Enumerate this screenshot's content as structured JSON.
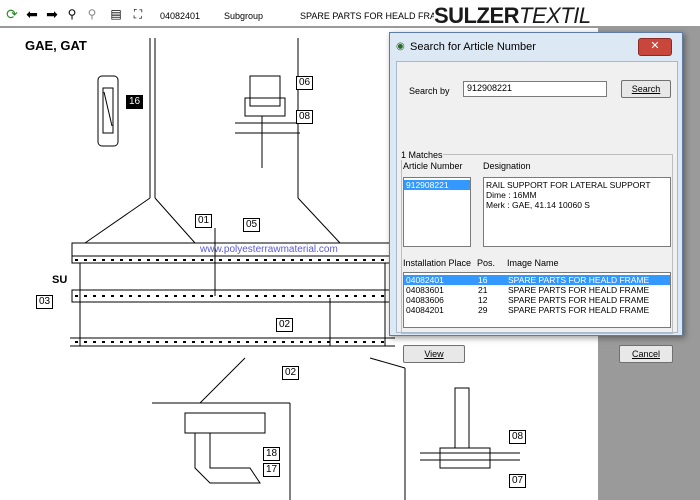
{
  "toolbar": {
    "doc_number": "04082401",
    "subgroup_label": "Subgroup",
    "page_title": "SPARE PARTS FOR HEALD FRAME",
    "logo_bold": "SULZER",
    "logo_light": "TEXTIL"
  },
  "drawing": {
    "model": "GAE, GAT",
    "side_label": "SU",
    "watermark": "www.polyesterrawmaterial.com",
    "parts": [
      "16",
      "06",
      "08",
      "01",
      "05",
      "03",
      "02",
      "02",
      "18",
      "17",
      "08",
      "07"
    ]
  },
  "dialog": {
    "title": "Search for Article Number",
    "close": "✕",
    "search_label": "Search by",
    "search_value": "912908221",
    "search_button": "Search",
    "matches": "1 Matches",
    "col_article": "Article Number",
    "col_designation": "Designation",
    "article_selected": "912908221",
    "designation_lines": [
      "RAIL SUPPORT FOR LATERAL SUPPORT",
      "Dime : 16MM",
      "Merk : GAE, 41.14 10060 S"
    ],
    "col_install": "Installation Place",
    "col_pos": "Pos.",
    "col_image": "Image Name",
    "rows": [
      {
        "place": "04082401",
        "pos": "16",
        "image": "SPARE PARTS FOR HEALD FRAME"
      },
      {
        "place": "04083601",
        "pos": "21",
        "image": "SPARE PARTS FOR HEALD FRAME"
      },
      {
        "place": "04083606",
        "pos": "12",
        "image": "SPARE PARTS FOR HEALD FRAME"
      },
      {
        "place": "04084201",
        "pos": "29",
        "image": "SPARE PARTS FOR HEALD FRAME"
      }
    ],
    "view_button": "View",
    "cancel_button": "Cancel"
  }
}
